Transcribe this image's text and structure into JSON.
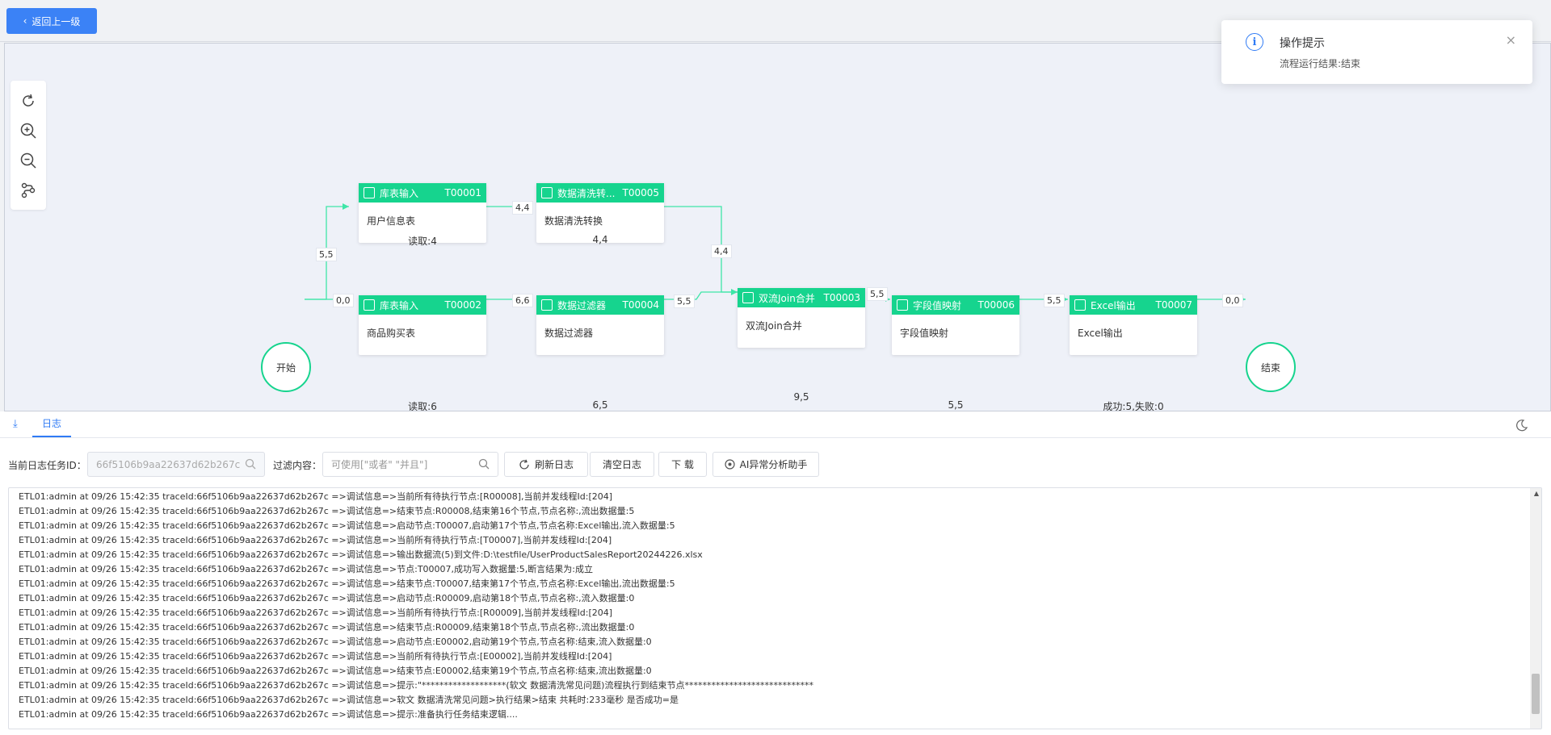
{
  "header": {
    "back_label": "返回上一级"
  },
  "toolbar": {
    "tools": [
      "refresh-icon",
      "zoom-in-icon",
      "zoom-out-icon",
      "layout-icon"
    ]
  },
  "flow": {
    "start_label": "开始",
    "end_label": "结束",
    "nodes": [
      {
        "title": "库表输入",
        "id": "T00001",
        "body": "用户信息表",
        "sub": "读取:4"
      },
      {
        "title": "数据清洗转...",
        "id": "T00005",
        "body": "数据清洗转换",
        "sub": "4,4"
      },
      {
        "title": "库表输入",
        "id": "T00002",
        "body": "商品购买表",
        "sub": "读取:6"
      },
      {
        "title": "数据过滤器",
        "id": "T00004",
        "body": "数据过滤器",
        "sub": "6,5"
      },
      {
        "title": "双流Join合并",
        "id": "T00003",
        "body": "双流Join合并",
        "sub": "9,5"
      },
      {
        "title": "字段值映射",
        "id": "T00006",
        "body": "字段值映射",
        "sub": "5,5"
      },
      {
        "title": "Excel输出",
        "id": "T00007",
        "body": "Excel输出",
        "sub": "成功:5,失败:0"
      }
    ],
    "edge_labels": [
      "5,5",
      "4,4",
      "0,0",
      "6,6",
      "4,4",
      "5,5",
      "5,5",
      "5,5",
      "0,0"
    ]
  },
  "toast": {
    "title": "操作提示",
    "message": "流程运行结果:结束",
    "close": "×",
    "info_glyph": "i"
  },
  "log": {
    "tab_label": "日志",
    "task_label": "当前日志任务ID：",
    "task_id": "66f5106b9aa22637d62b267c",
    "filter_label": "过滤内容：",
    "filter_placeholder": "可使用[\"或者\" \"并且\"]",
    "buttons": {
      "refresh": "刷新日志",
      "clear": "清空日志",
      "download": "下 载",
      "ai": "AI异常分析助手"
    },
    "lines": [
      "ETL01:admin at 09/26 15:42:35 traceId:66f5106b9aa22637d62b267c =>调试信息=>当前所有待执行节点:[R00008],当前并发线程Id:[204]",
      "ETL01:admin at 09/26 15:42:35 traceId:66f5106b9aa22637d62b267c =>调试信息=>结束节点:R00008,结束第16个节点,节点名称:,流出数据量:5",
      "ETL01:admin at 09/26 15:42:35 traceId:66f5106b9aa22637d62b267c =>调试信息=>启动节点:T00007,启动第17个节点,节点名称:Excel输出,流入数据量:5",
      "ETL01:admin at 09/26 15:42:35 traceId:66f5106b9aa22637d62b267c =>调试信息=>当前所有待执行节点:[T00007],当前并发线程Id:[204]",
      "ETL01:admin at 09/26 15:42:35 traceId:66f5106b9aa22637d62b267c =>调试信息=>输出数据流(5)到文件:D:\\testfile/UserProductSalesReport20244226.xlsx",
      "ETL01:admin at 09/26 15:42:35 traceId:66f5106b9aa22637d62b267c =>调试信息=>节点:T00007,成功写入数据量:5,断言结果为:成立",
      "ETL01:admin at 09/26 15:42:35 traceId:66f5106b9aa22637d62b267c =>调试信息=>结束节点:T00007,结束第17个节点,节点名称:Excel输出,流出数据量:5",
      "ETL01:admin at 09/26 15:42:35 traceId:66f5106b9aa22637d62b267c =>调试信息=>启动节点:R00009,启动第18个节点,节点名称:,流入数据量:0",
      "ETL01:admin at 09/26 15:42:35 traceId:66f5106b9aa22637d62b267c =>调试信息=>当前所有待执行节点:[R00009],当前并发线程Id:[204]",
      "ETL01:admin at 09/26 15:42:35 traceId:66f5106b9aa22637d62b267c =>调试信息=>结束节点:R00009,结束第18个节点,节点名称:,流出数据量:0",
      "ETL01:admin at 09/26 15:42:35 traceId:66f5106b9aa22637d62b267c =>调试信息=>启动节点:E00002,启动第19个节点,节点名称:结束,流入数据量:0",
      "ETL01:admin at 09/26 15:42:35 traceId:66f5106b9aa22637d62b267c =>调试信息=>当前所有待执行节点:[E00002],当前并发线程Id:[204]",
      "ETL01:admin at 09/26 15:42:35 traceId:66f5106b9aa22637d62b267c =>调试信息=>结束节点:E00002,结束第19个节点,节点名称:结束,流出数据量:0",
      "ETL01:admin at 09/26 15:42:35 traceId:66f5106b9aa22637d62b267c =>调试信息=>提示:\"*******************(软文 数据清洗常见问题)流程执行到结束节点*****************************",
      "ETL01:admin at 09/26 15:42:35 traceId:66f5106b9aa22637d62b267c =>调试信息=>软文 数据清洗常见问题>执行结果>结束 共耗时:233毫秒 是否成功=是",
      "ETL01:admin at 09/26 15:42:35 traceId:66f5106b9aa22637d62b267c =>调试信息=>提示:准备执行任务结束逻辑...."
    ]
  },
  "colors": {
    "accent": "#2f7bf5",
    "node_green": "#16d48e",
    "edge": "#3ee6a8"
  }
}
